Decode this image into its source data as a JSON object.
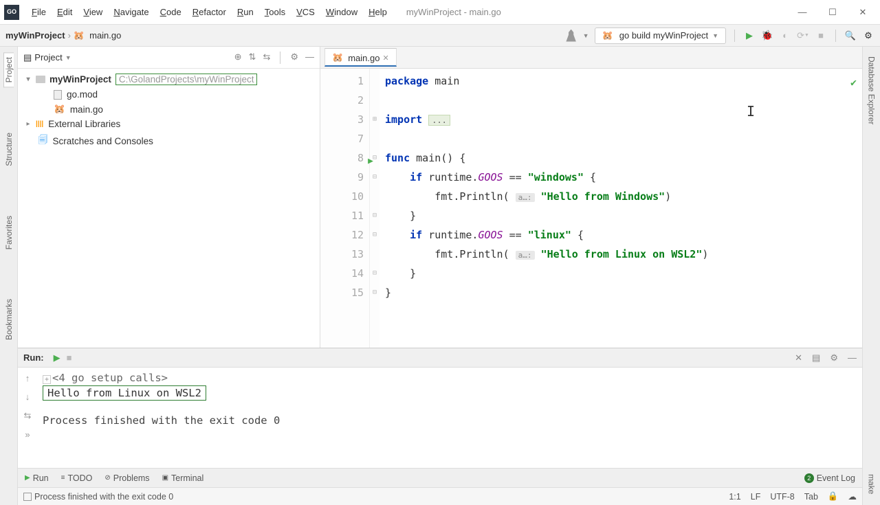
{
  "window": {
    "title": "myWinProject - main.go"
  },
  "menu": [
    "File",
    "Edit",
    "View",
    "Navigate",
    "Code",
    "Refactor",
    "Run",
    "Tools",
    "VCS",
    "Window",
    "Help"
  ],
  "breadcrumb": {
    "project": "myWinProject",
    "file": "main.go"
  },
  "run_config": {
    "label": "go build myWinProject"
  },
  "project_panel": {
    "title": "Project",
    "root": "myWinProject",
    "root_path": "C:\\GolandProjects\\myWinProject",
    "files": [
      "go.mod",
      "main.go"
    ],
    "external": "External Libraries",
    "scratches": "Scratches and Consoles"
  },
  "editor": {
    "tab": "main.go",
    "gutter": [
      "1",
      "2",
      "3",
      "7",
      "8",
      "9",
      "10",
      "11",
      "12",
      "13",
      "14",
      "15"
    ],
    "run_marker_line_index": 4,
    "code": {
      "l1_kw": "package",
      "l1_name": "main",
      "l3_kw": "import",
      "l3_ellip": "...",
      "l5_kw": "func",
      "l5_name": "main",
      "l5_paren": "() {",
      "l6_pre": "    ",
      "l6_kw": "if",
      "l6_mid": " runtime.",
      "l6_field": "GOOS",
      "l6_op": " == ",
      "l6_str": "\"windows\"",
      "l6_end": " {",
      "l7_pre": "        fmt.Println( ",
      "l7_hint": "a…:",
      "l7_sp": " ",
      "l7_str": "\"Hello from Windows\"",
      "l7_end": ")",
      "l8": "    }",
      "l9_pre": "    ",
      "l9_kw": "if",
      "l9_mid": " runtime.",
      "l9_field": "GOOS",
      "l9_op": " == ",
      "l9_str": "\"linux\"",
      "l9_end": " {",
      "l10_pre": "        fmt.Println( ",
      "l10_hint": "a…:",
      "l10_sp": " ",
      "l10_str": "\"Hello from Linux on WSL2\"",
      "l10_end": ")",
      "l11": "    }",
      "l12": "}"
    }
  },
  "run_panel": {
    "title": "Run:",
    "folded": "<4 go setup calls>",
    "output": "Hello from Linux on WSL2",
    "exit_msg": "Process finished with the exit code 0"
  },
  "bottom_tabs": {
    "run": "Run",
    "todo": "TODO",
    "problems": "Problems",
    "terminal": "Terminal",
    "eventlog": "Event Log",
    "badge": "2"
  },
  "status": {
    "msg": "Process finished with the exit code 0",
    "pos": "1:1",
    "le": "LF",
    "enc": "UTF-8",
    "indent": "Tab"
  },
  "rails": {
    "project": "Project",
    "structure": "Structure",
    "favorites": "Favorites",
    "bookmarks": "Bookmarks",
    "db": "Database Explorer",
    "make": "make"
  }
}
